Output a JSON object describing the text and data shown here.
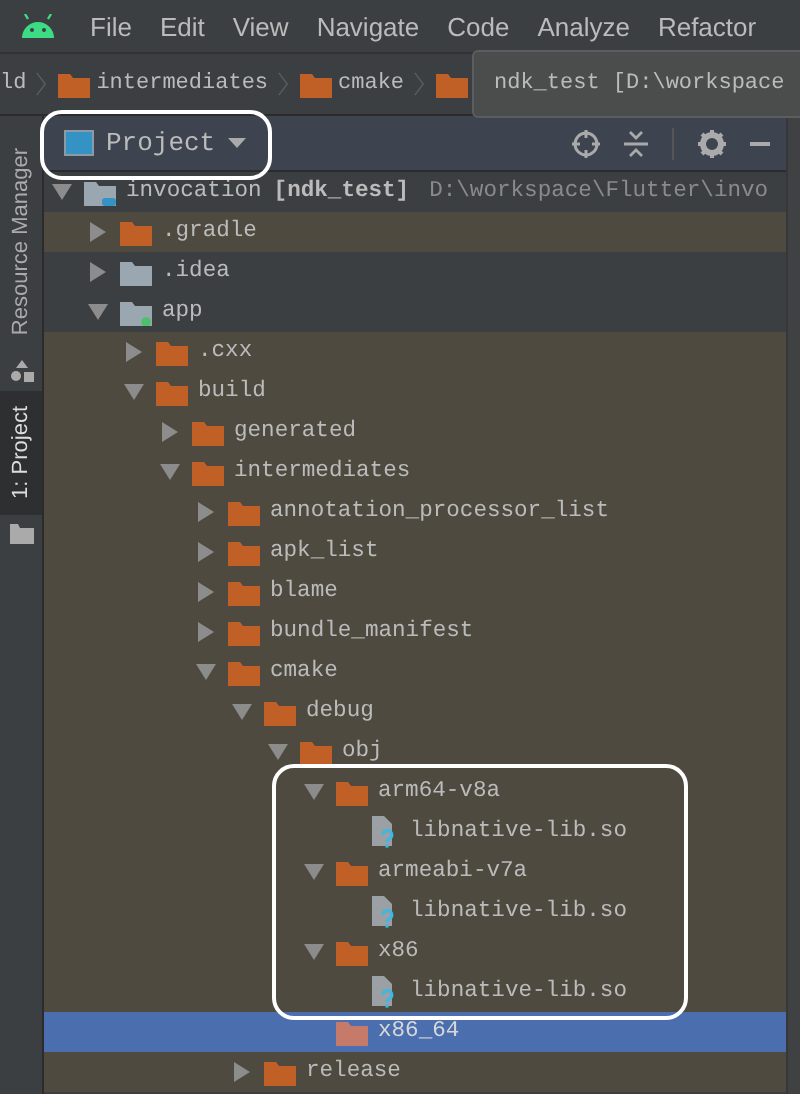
{
  "menu": [
    "File",
    "Edit",
    "View",
    "Navigate",
    "Code",
    "Analyze",
    "Refactor"
  ],
  "breadcrumbs": [
    "ld",
    "intermediates",
    "cmake"
  ],
  "tooltip": "ndk_test [D:\\workspace",
  "side_tabs": [
    {
      "label": "Resource Manager",
      "selected": false
    },
    {
      "label": "1: Project",
      "selected": true
    }
  ],
  "panel": {
    "title": "Project"
  },
  "tree": [
    {
      "kind": "module",
      "name": "invocation",
      "module": "[ndk_test]",
      "path": "D:\\workspace\\Flutter\\invo",
      "expanded": true,
      "excluded": false,
      "selected": false,
      "children": [
        {
          "kind": "folder",
          "name": ".gradle",
          "expanded": false,
          "excluded": true,
          "selected": false
        },
        {
          "kind": "folder",
          "name": ".idea",
          "expanded": false,
          "excluded": false,
          "selected": false
        },
        {
          "kind": "android-module",
          "name": "app",
          "expanded": true,
          "excluded": false,
          "selected": false,
          "children": [
            {
              "kind": "folder",
              "name": ".cxx",
              "expanded": false,
              "excluded": true,
              "selected": false
            },
            {
              "kind": "folder",
              "name": "build",
              "expanded": true,
              "excluded": true,
              "selected": false,
              "children": [
                {
                  "kind": "folder",
                  "name": "generated",
                  "expanded": false,
                  "excluded": true,
                  "selected": false
                },
                {
                  "kind": "folder",
                  "name": "intermediates",
                  "expanded": true,
                  "excluded": true,
                  "selected": false,
                  "children": [
                    {
                      "kind": "folder",
                      "name": "annotation_processor_list",
                      "expanded": false,
                      "excluded": true,
                      "selected": false
                    },
                    {
                      "kind": "folder",
                      "name": "apk_list",
                      "expanded": false,
                      "excluded": true,
                      "selected": false
                    },
                    {
                      "kind": "folder",
                      "name": "blame",
                      "expanded": false,
                      "excluded": true,
                      "selected": false
                    },
                    {
                      "kind": "folder",
                      "name": "bundle_manifest",
                      "expanded": false,
                      "excluded": true,
                      "selected": false
                    },
                    {
                      "kind": "folder",
                      "name": "cmake",
                      "expanded": true,
                      "excluded": true,
                      "selected": false,
                      "children": [
                        {
                          "kind": "folder",
                          "name": "debug",
                          "expanded": true,
                          "excluded": true,
                          "selected": false,
                          "children": [
                            {
                              "kind": "folder",
                              "name": "obj",
                              "expanded": true,
                              "excluded": true,
                              "selected": false,
                              "children": [
                                {
                                  "kind": "folder",
                                  "name": "arm64-v8a",
                                  "expanded": true,
                                  "excluded": true,
                                  "selected": false,
                                  "children": [
                                    {
                                      "kind": "file",
                                      "name": "libnative-lib.so",
                                      "excluded": true,
                                      "selected": false
                                    }
                                  ]
                                },
                                {
                                  "kind": "folder",
                                  "name": "armeabi-v7a",
                                  "expanded": true,
                                  "excluded": true,
                                  "selected": false,
                                  "children": [
                                    {
                                      "kind": "file",
                                      "name": "libnative-lib.so",
                                      "excluded": true,
                                      "selected": false
                                    }
                                  ]
                                },
                                {
                                  "kind": "folder",
                                  "name": "x86",
                                  "expanded": true,
                                  "excluded": true,
                                  "selected": false,
                                  "children": [
                                    {
                                      "kind": "file",
                                      "name": "libnative-lib.so",
                                      "excluded": true,
                                      "selected": false
                                    }
                                  ]
                                },
                                {
                                  "kind": "empty-folder",
                                  "name": "x86_64",
                                  "excluded": true,
                                  "selected": true
                                }
                              ]
                            }
                          ]
                        },
                        {
                          "kind": "folder",
                          "name": "release",
                          "expanded": false,
                          "excluded": true,
                          "selected": false
                        }
                      ]
                    }
                  ]
                }
              ]
            }
          ]
        }
      ]
    }
  ]
}
